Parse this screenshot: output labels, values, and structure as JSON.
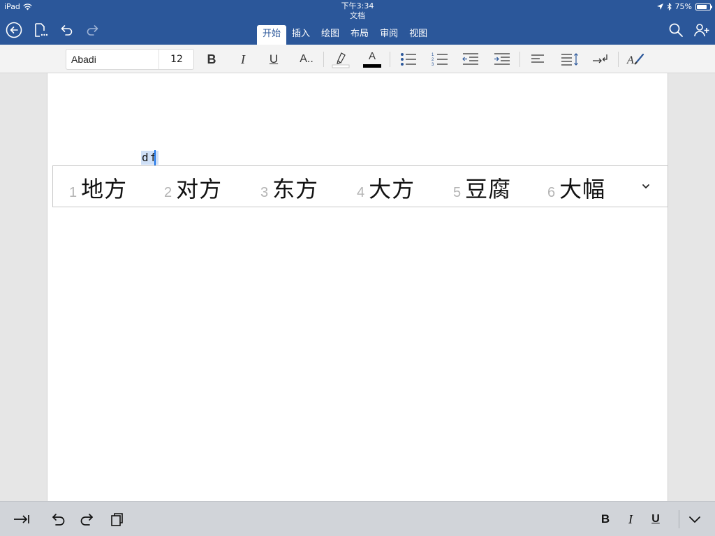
{
  "status": {
    "device": "iPad",
    "time": "下午3:34",
    "battery": "75%",
    "battery_level": 0.75
  },
  "document": {
    "title": "文档",
    "typed_text": "df"
  },
  "tabs": [
    {
      "label": "开始",
      "active": true
    },
    {
      "label": "插入",
      "active": false
    },
    {
      "label": "绘图",
      "active": false
    },
    {
      "label": "布局",
      "active": false
    },
    {
      "label": "审阅",
      "active": false
    },
    {
      "label": "视图",
      "active": false
    }
  ],
  "ribbon": {
    "font_name": "Abadi",
    "font_size": "12",
    "bold_label": "B",
    "italic_label": "I",
    "underline_label": "U",
    "font_effects_label": "A..",
    "font_color_label": "A",
    "font_color": "#000000",
    "highlight_color": "#ffffff"
  },
  "candidates": [
    {
      "num": "1",
      "text": "地方"
    },
    {
      "num": "2",
      "text": "对方"
    },
    {
      "num": "3",
      "text": "东方"
    },
    {
      "num": "4",
      "text": "大方"
    },
    {
      "num": "5",
      "text": "豆腐"
    },
    {
      "num": "6",
      "text": "大幅"
    }
  ],
  "bottombar": {
    "bold_label": "B",
    "italic_label": "I",
    "underline_label": "U"
  },
  "colors": {
    "brand": "#2b579a",
    "page": "#ffffff",
    "canvas": "#e6e6e6"
  }
}
